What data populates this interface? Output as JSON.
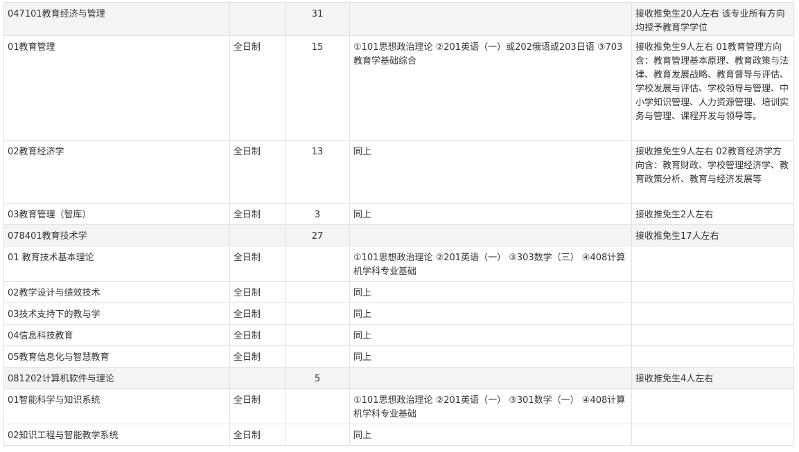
{
  "table": {
    "rows": [
      {
        "type": "major",
        "name": "047101教育经济与管理",
        "mode": "",
        "plan": "31",
        "exams": "",
        "notes": "接收推免生20人左右 该专业所有方向均授予教育学学位",
        "h": 31
      },
      {
        "type": "sub",
        "name": "01教育管理",
        "mode": "全日制",
        "plan": "15",
        "exams": "①101思想政治理论 ②201英语（一）或202俄语或203日语 ③703教育学基础综合",
        "notes": "接收推免生9人左右 01教育管理方向含：教育管理基本原理、教育政策与法律、教育发展战略、教育督导与评估、学校发展与评估、学校领导与管理、中小学知识管理、人力资源管理、培训实务与管理、课程开发与领导等。",
        "h": 151
      },
      {
        "type": "sub",
        "name": "02教育经济学",
        "mode": "全日制",
        "plan": "13",
        "exams": "同上",
        "notes": "接收推免生9人左右 02教育经济学方向含：教育财政、学校管理经济学、教育政策分析、教育与经济发展等",
        "h": 91
      },
      {
        "type": "sub",
        "name": "03教育管理（智库）",
        "mode": "全日制",
        "plan": "3",
        "exams": "同上",
        "notes": "接收推免生2人左右",
        "h": 31
      },
      {
        "type": "major",
        "name": "078401教育技术学",
        "mode": "",
        "plan": "27",
        "exams": "",
        "notes": "接收推免生17人左右",
        "h": 31
      },
      {
        "type": "sub",
        "name": "01 教育技术基本理论",
        "mode": "全日制",
        "plan": "",
        "exams": "①101思想政治理论 ②201英语（一） ③303数学（三） ④408计算机学科专业基础",
        "notes": "",
        "h": 51
      },
      {
        "type": "sub",
        "name": "02教学设计与绩效技术",
        "mode": "全日制",
        "plan": "",
        "exams": "同上",
        "notes": "",
        "h": 31
      },
      {
        "type": "sub",
        "name": "03技术支持下的教与学",
        "mode": "全日制",
        "plan": "",
        "exams": "同上",
        "notes": "",
        "h": 31
      },
      {
        "type": "sub",
        "name": "04信息科技教育",
        "mode": "全日制",
        "plan": "",
        "exams": "同上",
        "notes": "",
        "h": 31
      },
      {
        "type": "sub",
        "name": "05教育信息化与智慧教育",
        "mode": "全日制",
        "plan": "",
        "exams": "同上",
        "notes": "",
        "h": 31
      },
      {
        "type": "major",
        "name": "081202计算机软件与理论",
        "mode": "",
        "plan": "5",
        "exams": "",
        "notes": "接收推免生4人左右",
        "h": 31
      },
      {
        "type": "sub",
        "name": "01智能科学与知识系统",
        "mode": "全日制",
        "plan": "",
        "exams": "①101思想政治理论 ②201英语（一） ③301数学（一） ④408计算机学科专业基础",
        "notes": "",
        "h": 51
      },
      {
        "type": "sub",
        "name": "02知识工程与智能教学系统",
        "mode": "全日制",
        "plan": "",
        "exams": "同上",
        "notes": "",
        "h": 31
      }
    ]
  }
}
